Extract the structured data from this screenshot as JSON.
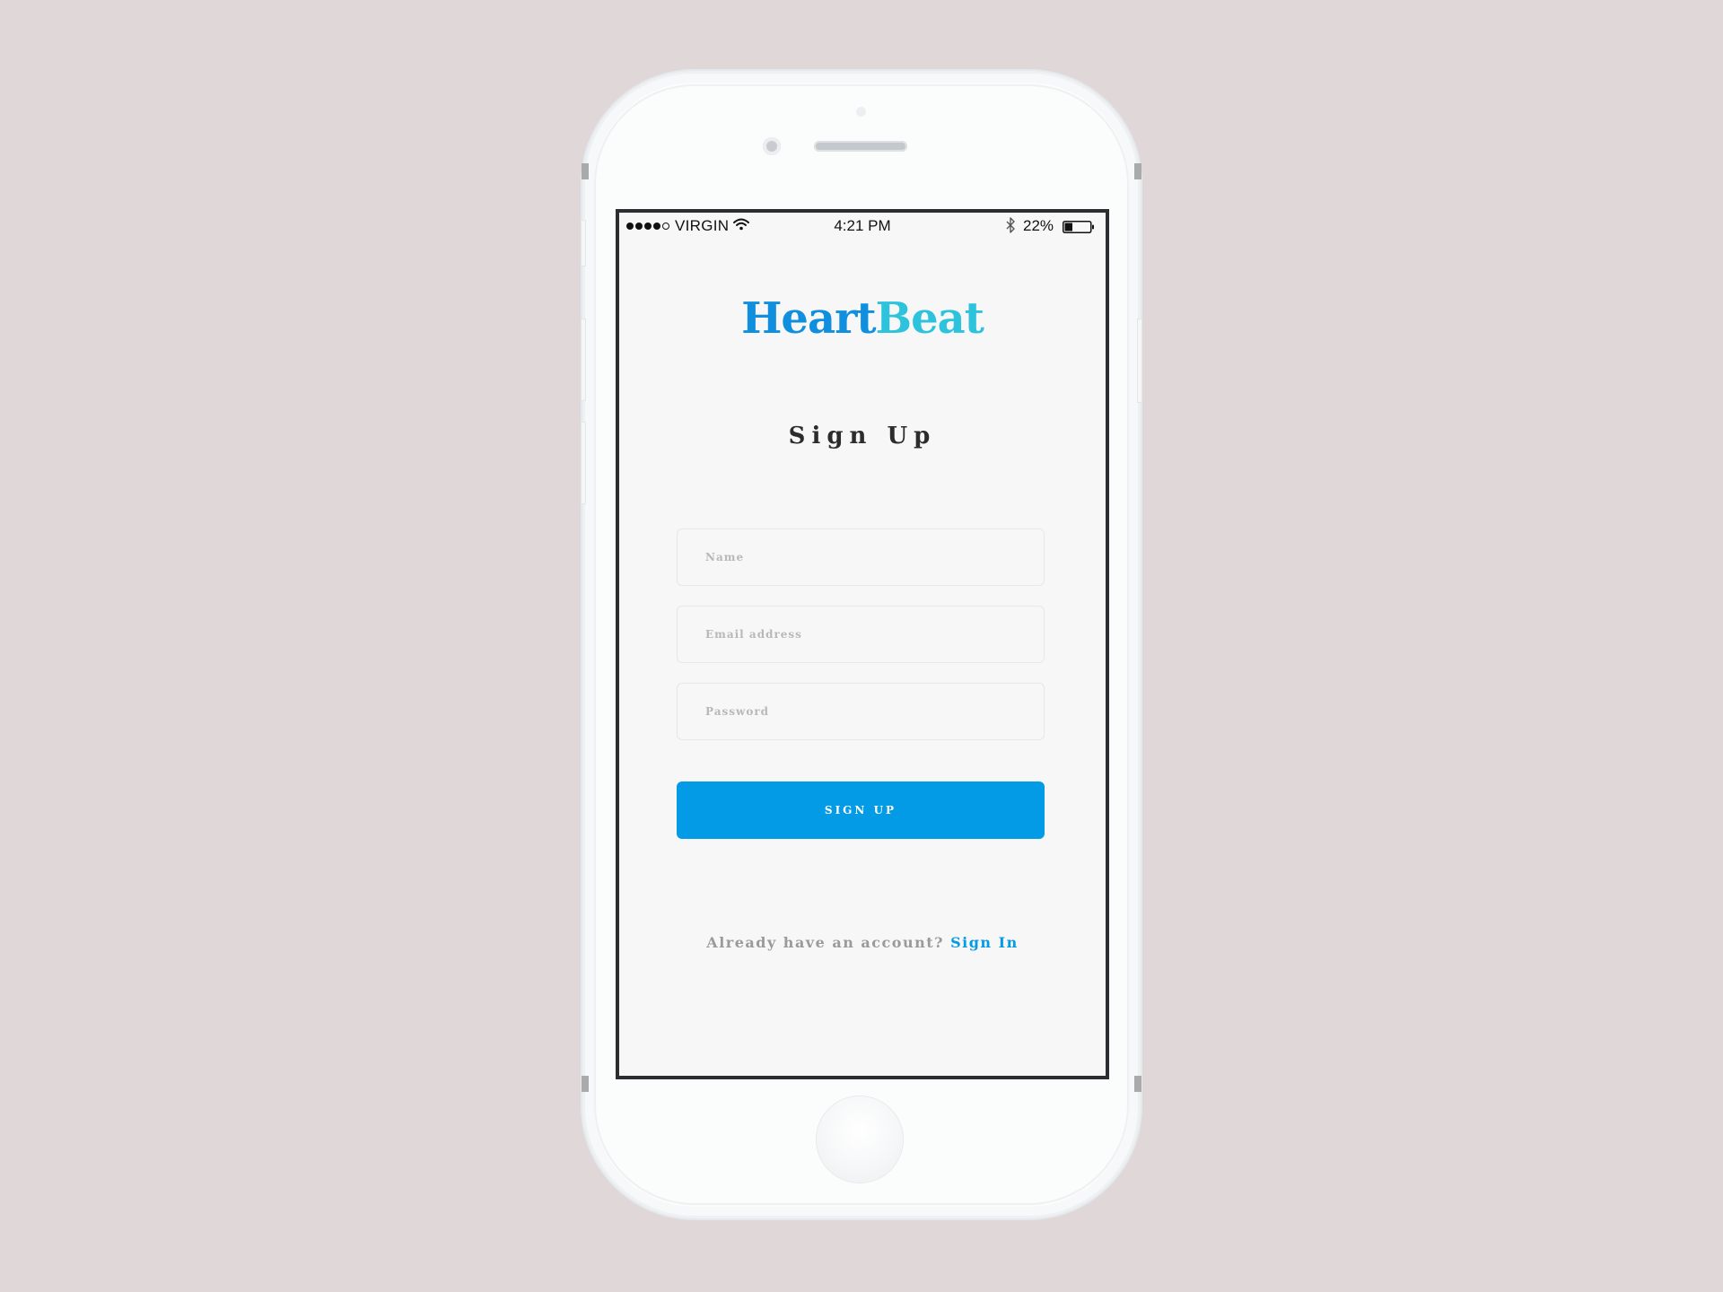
{
  "status_bar": {
    "carrier": "VIRGIN",
    "time": "4:21 PM",
    "battery_percent": "22%",
    "signal_bars_filled": 4,
    "signal_bars_total": 5,
    "battery_level": 0.22,
    "icons": [
      "signal-dots-icon",
      "wifi-icon",
      "bluetooth-icon",
      "battery-icon"
    ]
  },
  "logo": {
    "part1": "Heart",
    "part2": "Beat",
    "colors": {
      "part1": "#0f8fde",
      "part2": "#2dc3dc"
    }
  },
  "page": {
    "title": "Sign Up"
  },
  "form": {
    "name_placeholder": "Name",
    "email_placeholder": "Email address",
    "password_placeholder": "Password",
    "name_value": "",
    "email_value": "",
    "password_value": "",
    "submit_label": "SIGN UP"
  },
  "footer": {
    "prompt": "Already have an account?",
    "link_label": "Sign In"
  },
  "colors": {
    "background": "#e0d8d8",
    "accent": "#039be5",
    "screen": "#f7f7f7",
    "muted_text": "#9a9a9a"
  }
}
